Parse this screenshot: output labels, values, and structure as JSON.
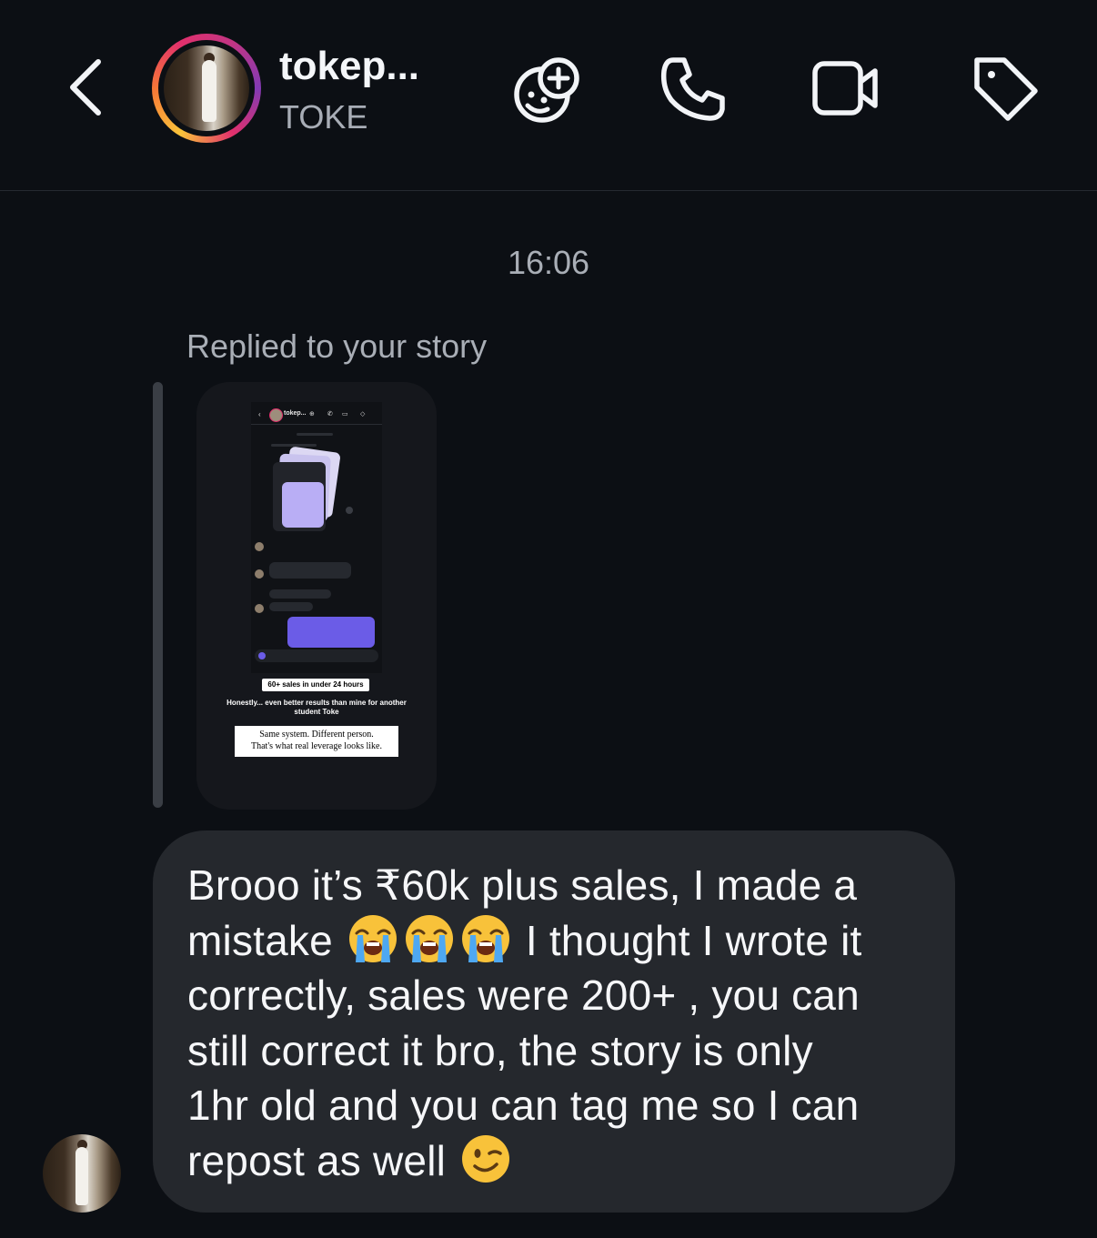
{
  "header": {
    "back_icon": "chevron-left-icon",
    "username": "tokep...",
    "subtitle": "TOKE",
    "actions": [
      {
        "name": "add-sticker-icon",
        "label": "add-sticker"
      },
      {
        "name": "phone-icon",
        "label": "audio-call"
      },
      {
        "name": "video-icon",
        "label": "video-call"
      },
      {
        "name": "tag-icon",
        "label": "tag"
      }
    ]
  },
  "conversation": {
    "timestamp": "16:06",
    "reply_context": "Replied to your story",
    "story": {
      "mini_header": "tokep...",
      "label_top": "60+ sales in under 24 hours",
      "caption": "Honestly... even better results than mine for another student Toke",
      "label_bottom_1": "Same system. Different person.",
      "label_bottom_2": "That's what real leverage looks like."
    },
    "message": {
      "line1": "Brooo it’s ₹60k plus sales, I made a",
      "line2_start": "mistake",
      "line2_end": "I thought I wrote it",
      "line3": "correctly, sales were 200+ , you can",
      "line4": "still correct it bro, the story is only",
      "line5": "1hr old and you can tag me so I can",
      "line6_start": "repost as well",
      "emojis": [
        "loudly-crying-face-emoji",
        "loudly-crying-face-emoji",
        "loudly-crying-face-emoji",
        "winking-face-emoji"
      ]
    }
  },
  "colors": {
    "background": "#0c0f14",
    "bubble": "#25282d",
    "muted_text": "#a9aeb6",
    "story_ring": "#e1306c"
  }
}
